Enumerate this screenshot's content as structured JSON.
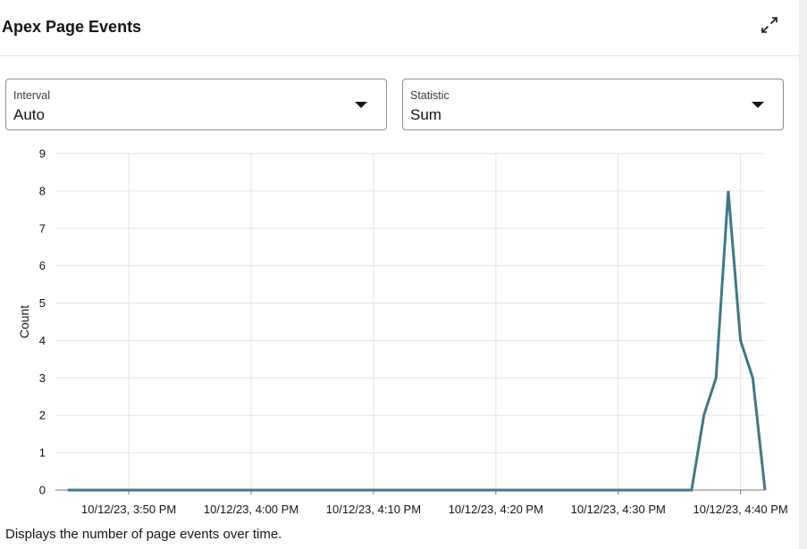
{
  "panel": {
    "title": "Apex Page Events",
    "expand_icon": "expand-icon",
    "description": "Displays the number of page events over time."
  },
  "filters": {
    "interval": {
      "label": "Interval",
      "value": "Auto"
    },
    "statistic": {
      "label": "Statistic",
      "value": "Sum"
    }
  },
  "colors": {
    "series": "#3e7987",
    "grid": "#e7e5e2",
    "axis": "#7a7773",
    "text": "#161513"
  },
  "chart_data": {
    "type": "line",
    "title": "",
    "xlabel": "",
    "ylabel": "Count",
    "ylim": [
      0,
      9
    ],
    "yticks": [
      0,
      1,
      2,
      3,
      4,
      5,
      6,
      7,
      8,
      9
    ],
    "xlim": [
      "10/12/23, 3:44 PM",
      "10/12/23, 4:42 PM"
    ],
    "xticks": [
      {
        "time": "10/12/23, 3:50 PM",
        "label": "10/12/23, 3:50 PM"
      },
      {
        "time": "10/12/23, 4:00 PM",
        "label": "10/12/23, 4:00 PM"
      },
      {
        "time": "10/12/23, 4:10 PM",
        "label": "10/12/23, 4:10 PM"
      },
      {
        "time": "10/12/23, 4:20 PM",
        "label": "10/12/23, 4:20 PM"
      },
      {
        "time": "10/12/23, 4:30 PM",
        "label": "10/12/23, 4:30 PM"
      },
      {
        "time": "10/12/23, 4:40 PM",
        "label": "10/12/23, 4:40 PM"
      }
    ],
    "grid": true,
    "legend": "none",
    "series": [
      {
        "points": [
          {
            "time": "10/12/23, 3:45 PM",
            "value": 0
          },
          {
            "time": "10/12/23, 4:36 PM",
            "value": 0
          },
          {
            "time": "10/12/23, 4:37 PM",
            "value": 2
          },
          {
            "time": "10/12/23, 4:38 PM",
            "value": 3
          },
          {
            "time": "10/12/23, 4:39 PM",
            "value": 8
          },
          {
            "time": "10/12/23, 4:40 PM",
            "value": 4
          },
          {
            "time": "10/12/23, 4:41 PM",
            "value": 3
          },
          {
            "time": "10/12/23, 4:42 PM",
            "value": 0
          }
        ]
      }
    ]
  }
}
